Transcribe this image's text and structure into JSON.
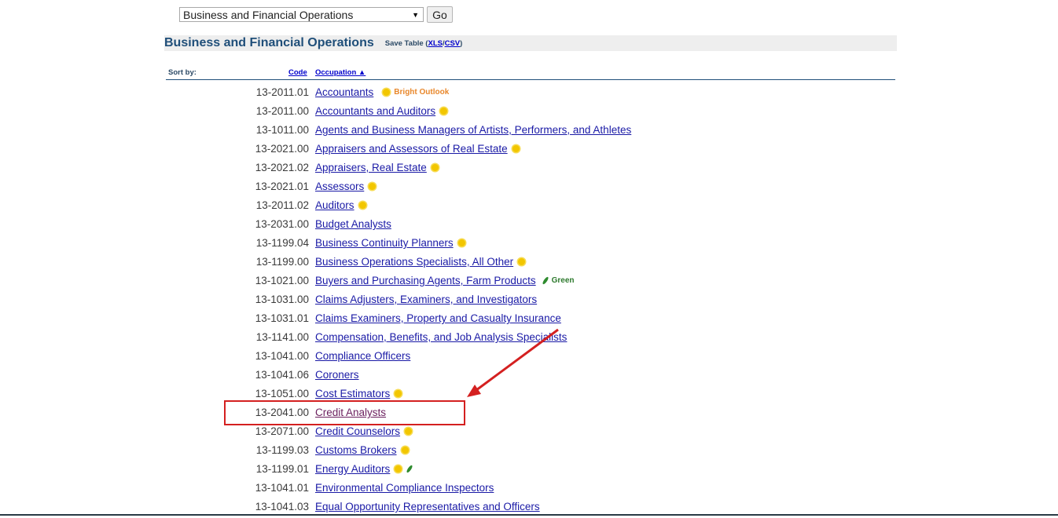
{
  "toolbar": {
    "select_value": "Business and Financial Operations",
    "go_label": "Go"
  },
  "header": {
    "title": "Business and Financial Operations",
    "save_prefix": "Save Table (",
    "save_xls": "XLS",
    "save_sep": "/",
    "save_csv": "CSV",
    "save_suffix": ")"
  },
  "sort": {
    "label": "Sort by:",
    "code": "Code",
    "occupation": "Occupation ▲"
  },
  "badges": {
    "bright_outlook": "Bright Outlook",
    "green": "Green"
  },
  "colors": {
    "title": "#1f4e79",
    "link": "#1a1aa6",
    "visited_link": "#6b1f5e",
    "bright_outlook": "#e8872b",
    "green": "#2e7a2e",
    "annotation": "#d42020"
  },
  "rows": [
    {
      "code": "13-2011.01",
      "occupation": "Accountants",
      "bright": true,
      "bright_label": true,
      "green": false
    },
    {
      "code": "13-2011.00",
      "occupation": "Accountants and Auditors",
      "bright": true,
      "green": false
    },
    {
      "code": "13-1011.00",
      "occupation": "Agents and Business Managers of Artists, Performers, and Athletes",
      "bright": false,
      "green": false
    },
    {
      "code": "13-2021.00",
      "occupation": "Appraisers and Assessors of Real Estate",
      "bright": true,
      "green": false
    },
    {
      "code": "13-2021.02",
      "occupation": "Appraisers, Real Estate",
      "bright": true,
      "green": false
    },
    {
      "code": "13-2021.01",
      "occupation": "Assessors",
      "bright": true,
      "green": false
    },
    {
      "code": "13-2011.02",
      "occupation": "Auditors",
      "bright": true,
      "green": false
    },
    {
      "code": "13-2031.00",
      "occupation": "Budget Analysts",
      "bright": false,
      "green": false
    },
    {
      "code": "13-1199.04",
      "occupation": "Business Continuity Planners",
      "bright": true,
      "green": false
    },
    {
      "code": "13-1199.00",
      "occupation": "Business Operations Specialists, All Other",
      "bright": true,
      "green": false
    },
    {
      "code": "13-1021.00",
      "occupation": "Buyers and Purchasing Agents, Farm Products",
      "bright": false,
      "green": true,
      "green_label": true
    },
    {
      "code": "13-1031.00",
      "occupation": "Claims Adjusters, Examiners, and Investigators",
      "bright": false,
      "green": false
    },
    {
      "code": "13-1031.01",
      "occupation": "Claims Examiners, Property and Casualty Insurance",
      "bright": false,
      "green": false
    },
    {
      "code": "13-1141.00",
      "occupation": "Compensation, Benefits, and Job Analysis Specialists",
      "bright": false,
      "green": false
    },
    {
      "code": "13-1041.00",
      "occupation": "Compliance Officers",
      "bright": false,
      "green": false
    },
    {
      "code": "13-1041.06",
      "occupation": "Coroners",
      "bright": false,
      "green": false
    },
    {
      "code": "13-1051.00",
      "occupation": "Cost Estimators",
      "bright": true,
      "green": false
    },
    {
      "code": "13-2041.00",
      "occupation": "Credit Analysts",
      "bright": false,
      "green": false,
      "visited": true,
      "highlighted": true
    },
    {
      "code": "13-2071.00",
      "occupation": "Credit Counselors",
      "bright": true,
      "green": false
    },
    {
      "code": "13-1199.03",
      "occupation": "Customs Brokers",
      "bright": true,
      "green": false
    },
    {
      "code": "13-1199.01",
      "occupation": "Energy Auditors",
      "bright": true,
      "green": true
    },
    {
      "code": "13-1041.01",
      "occupation": "Environmental Compliance Inspectors",
      "bright": false,
      "green": false
    },
    {
      "code": "13-1041.03",
      "occupation": "Equal Opportunity Representatives and Officers",
      "bright": false,
      "green": false
    }
  ]
}
